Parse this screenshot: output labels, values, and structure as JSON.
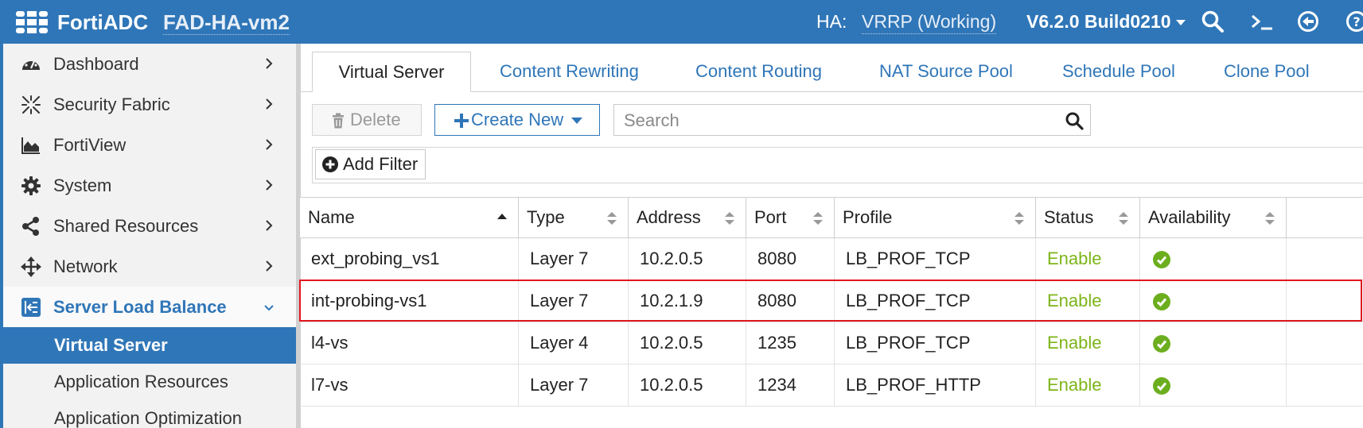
{
  "header": {
    "app_name": "FortiADC",
    "hostname": "FAD-HA-vm2",
    "ha_label": "HA:",
    "ha_value": "VRRP (Working)",
    "version": "V6.2.0 Build0210",
    "icons": [
      "logo-icon",
      "search-icon",
      "cli-icon",
      "logout-icon",
      "help-icon"
    ],
    "brand_color": "#2f76b8"
  },
  "sidebar": {
    "items": [
      {
        "label": "Dashboard",
        "icon": "dashboard-icon"
      },
      {
        "label": "Security Fabric",
        "icon": "security-fabric-icon"
      },
      {
        "label": "FortiView",
        "icon": "area-chart-icon"
      },
      {
        "label": "System",
        "icon": "gear-icon"
      },
      {
        "label": "Shared Resources",
        "icon": "share-icon"
      },
      {
        "label": "Network",
        "icon": "move-arrows-icon"
      },
      {
        "label": "Server Load Balance",
        "icon": "load-balance-icon",
        "expanded": true
      }
    ],
    "sub_items": [
      {
        "label": "Virtual Server",
        "selected": true
      },
      {
        "label": "Application Resources"
      },
      {
        "label": "Application Optimization"
      }
    ]
  },
  "tabs": [
    {
      "label": "Virtual Server",
      "active": true
    },
    {
      "label": "Content Rewriting"
    },
    {
      "label": "Content Routing"
    },
    {
      "label": "NAT Source Pool"
    },
    {
      "label": "Schedule Pool"
    },
    {
      "label": "Clone Pool"
    }
  ],
  "toolbar": {
    "delete_label": "Delete",
    "create_label": "Create New",
    "search_placeholder": "Search",
    "add_filter_label": "Add Filter"
  },
  "table": {
    "columns": [
      "Name",
      "Type",
      "Address",
      "Port",
      "Profile",
      "Status",
      "Availability"
    ],
    "sorted_column": "Name",
    "rows": [
      {
        "name": "ext_probing_vs1",
        "type": "Layer 7",
        "address": "10.2.0.5",
        "port": "8080",
        "profile": "LB_PROF_TCP",
        "status": "Enable",
        "availability": "check-circle-icon"
      },
      {
        "name": "int-probing-vs1",
        "type": "Layer 7",
        "address": "10.2.1.9",
        "port": "8080",
        "profile": "LB_PROF_TCP",
        "status": "Enable",
        "availability": "check-circle-icon",
        "highlighted": true
      },
      {
        "name": "l4-vs",
        "type": "Layer 4",
        "address": "10.2.0.5",
        "port": "1235",
        "profile": "LB_PROF_TCP",
        "status": "Enable",
        "availability": "check-circle-icon"
      },
      {
        "name": "l7-vs",
        "type": "Layer 7",
        "address": "10.2.0.5",
        "port": "1234",
        "profile": "LB_PROF_HTTP",
        "status": "Enable",
        "availability": "check-circle-icon"
      }
    ],
    "status_color": "#7cb518",
    "highlight_color": "#e0161f"
  }
}
